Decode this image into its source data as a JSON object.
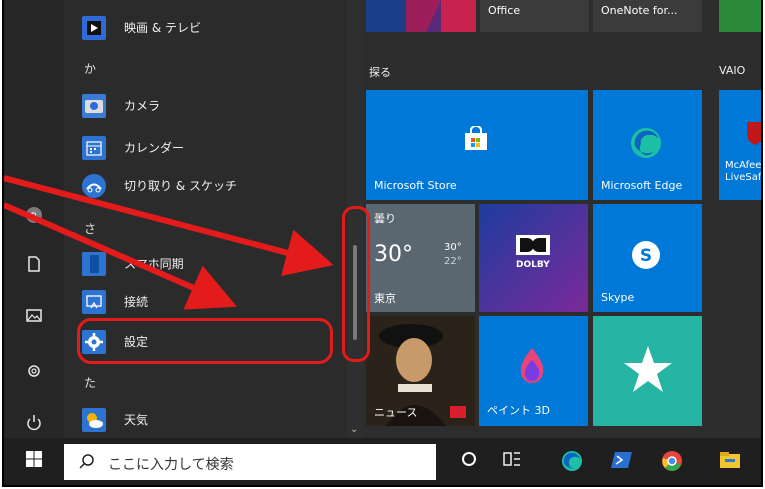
{
  "start_menu": {
    "app_list": {
      "items": [
        {
          "label": "映画 & テレビ",
          "icon": "movies-tv-icon",
          "color": "#2f6bd8"
        },
        {
          "label": "カメラ",
          "icon": "camera-icon",
          "color": "#3a7bd5"
        },
        {
          "label": "カレンダー",
          "icon": "calendar-icon",
          "color": "#2d74d2"
        },
        {
          "label": "切り取り & スケッチ",
          "icon": "snip-sketch-icon",
          "color": "#2d74d2"
        },
        {
          "label": "スマホ同期",
          "icon": "phone-icon",
          "color": "#2d74d2"
        },
        {
          "label": "接続",
          "icon": "connect-icon",
          "color": "#2d74d2"
        },
        {
          "label": "設定",
          "icon": "gear-icon",
          "color": "#2d74d2"
        },
        {
          "label": "天気",
          "icon": "weather-icon",
          "color": "#2d74d2"
        }
      ],
      "letters": [
        "か",
        "さ",
        "た"
      ]
    },
    "tiles": {
      "top_labels": [
        "Office",
        "OneNote for..."
      ],
      "section_explore": "探る",
      "section_vaio": "VAIO",
      "store": "Microsoft Store",
      "edge": "Microsoft Edge",
      "mcafee": "McAfee LiveSafe",
      "weather": {
        "condition": "曇り",
        "temp": "30°",
        "high": "30°",
        "low": "22°",
        "city": "東京"
      },
      "dolby": "DOLBY",
      "skype": "Skype",
      "news": "ニュース",
      "paint3d": "ペイント 3D"
    }
  },
  "taskbar": {
    "search_placeholder": "ここに入力して検索"
  },
  "colors": {
    "tile_blue": "#0078d7",
    "annotation_red": "#e31b1b"
  }
}
